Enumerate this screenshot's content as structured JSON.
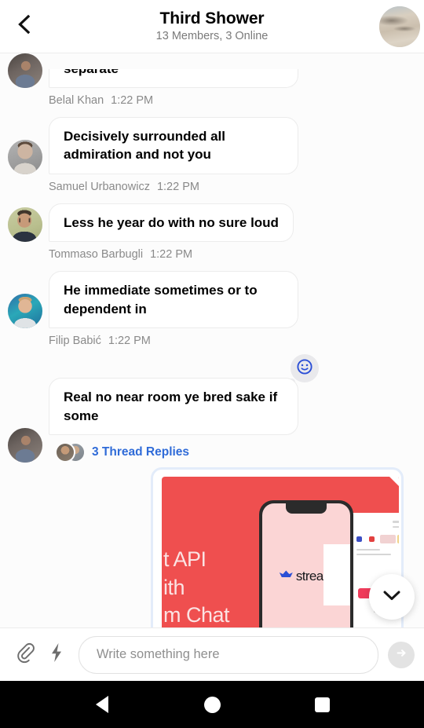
{
  "header": {
    "back_icon": "chevron-left-icon",
    "title": "Third Shower",
    "subtitle": "13 Members, 3 Online",
    "avatar_alt": "channel-avatar"
  },
  "messages": [
    {
      "id": "m1",
      "author": "Belal Khan",
      "time": "1:22 PM",
      "text": "separate",
      "clipped": true
    },
    {
      "id": "m2",
      "author": "Samuel Urbanowicz",
      "time": "1:22 PM",
      "text": "Decisively surrounded all admiration and not you",
      "clipped": false
    },
    {
      "id": "m3",
      "author": "Tommaso Barbugli",
      "time": "1:22 PM",
      "text": "Less he year do with no sure loud",
      "clipped": false
    },
    {
      "id": "m4",
      "author": "Filip Babić",
      "time": "1:22 PM",
      "text": "He immediate sometimes or to dependent in",
      "clipped": false
    },
    {
      "id": "m5",
      "author": "",
      "time": "",
      "text": "Real no near room ye bred sake if some",
      "clipped": false,
      "reaction_icon": "smiley-face-icon",
      "thread_label": "3 Thread Replies"
    }
  ],
  "attachment": {
    "name": "stream-chat-promo-image",
    "promo_text": "t API\nith\nm Chat",
    "brand": "stream",
    "bg_color": "#ef4f4f",
    "frame_color": "#e3ecfa"
  },
  "scroll_fab": {
    "icon": "chevron-down-icon",
    "label": "Scroll to bottom"
  },
  "composer": {
    "attach_icon": "paperclip-icon",
    "command_icon": "lightning-bolt-icon",
    "placeholder": "Write something here",
    "value": "",
    "send_icon": "arrow-right-icon"
  },
  "navbar": {
    "back": "android-back-button",
    "home": "android-home-button",
    "recents": "android-recents-button"
  },
  "colors": {
    "accent_link": "#2f6bd8",
    "promo_red": "#ef4f4f",
    "bubble_bg": "#ffffff",
    "list_bg": "#fcfcfc"
  }
}
